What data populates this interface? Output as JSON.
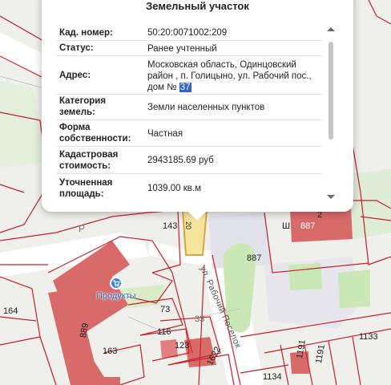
{
  "popup": {
    "title": "Земельный участок",
    "rows": [
      {
        "key": "Кад. номер:",
        "value": "50:20:0071002:209"
      },
      {
        "key": "Статус:",
        "value": "Ранее учтенный"
      },
      {
        "key": "Адрес:",
        "value": "Московская область, Одинцовский район , п. Голицыно, ул. Рабочий пос., дом №",
        "highlight": "37"
      },
      {
        "key": "Категория земель:",
        "value": "Земли населенных пунктов"
      },
      {
        "key": "Форма собственности:",
        "value": "Частная"
      },
      {
        "key": "Кадастровая стоимость:",
        "value": "2943185.69 руб"
      },
      {
        "key": "Уточненная площадь:",
        "value": "1039.00 кв.м"
      }
    ]
  },
  "map": {
    "parcel_numbers": {
      "p143": "143",
      "p20": "20",
      "p887a": "887",
      "p887b": "887",
      "p164": "164",
      "p889": "889",
      "p163": "163",
      "p73": "73",
      "p116": "116",
      "p123": "123",
      "p33": "33",
      "p1622": "1622",
      "p1191a": "1191",
      "p1191b": "1191",
      "p1133": "1133",
      "p1134": "1134",
      "p2": "2"
    },
    "letter_p": "Р",
    "letter_sh": "Ш",
    "street_name": "ул. Рабочий Поселок",
    "poi_label": "Продукты",
    "colors": {
      "parcel_line": "#c8202a",
      "building": "#d86a6a",
      "selected_parcel": "#f6e39c",
      "green": "#c9e8b6",
      "road": "#ffffff",
      "popup_highlight": "#2f63c7"
    }
  }
}
